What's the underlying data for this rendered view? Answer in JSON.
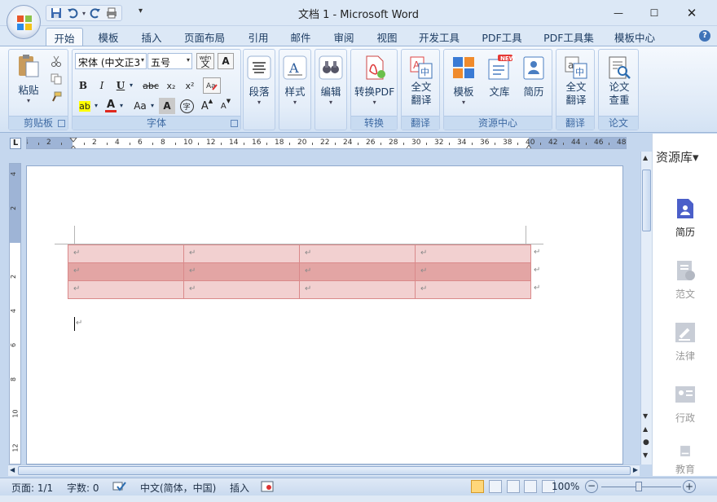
{
  "window": {
    "title": "文档 1 - Microsoft Word",
    "minimize": "—",
    "maximize": "☐",
    "close": "✕"
  },
  "qat": {
    "customize": "▾"
  },
  "tabs": [
    "开始",
    "模板",
    "插入",
    "页面布局",
    "引用",
    "邮件",
    "审阅",
    "视图",
    "开发工具",
    "PDF工具",
    "PDF工具集",
    "模板中心"
  ],
  "active_tab": "开始",
  "help": "?",
  "ribbon": {
    "clipboard": {
      "label": "剪贴板",
      "paste": "粘贴"
    },
    "font": {
      "label": "字体",
      "font_name": "宋体 (中文正3",
      "font_size": "五号",
      "wen_label": "wén",
      "wen_char": "文",
      "a_boxed": "A",
      "bold": "B",
      "italic": "I",
      "underline": "U",
      "strike": "abc",
      "subscript": "x₂",
      "superscript": "x²",
      "highlight": "ab",
      "font_color": "A",
      "change_case": "Aa",
      "char_shade": "A",
      "enclose": "字",
      "grow": "A",
      "shrink": "A"
    },
    "paragraph": {
      "label": "段落"
    },
    "styles": {
      "label": "样式"
    },
    "editing": {
      "label": "编辑"
    },
    "convert": {
      "group": "转换",
      "button": "转换PDF"
    },
    "translate": {
      "group": "翻译",
      "button_line1": "全文",
      "button_line2": "翻译"
    },
    "resource": {
      "group": "资源中心",
      "template": "模板",
      "library": "文库",
      "resume": "简历",
      "new_badge": "NEW"
    },
    "translate2": {
      "group": "翻译",
      "button_line1": "全文",
      "button_line2": "翻译"
    },
    "paper": {
      "group": "论文",
      "button_line1": "论文",
      "button_line2": "查重"
    }
  },
  "ruler": {
    "h_labels": [
      "4",
      "2",
      "",
      "2",
      "4",
      "6",
      "8",
      "10",
      "12",
      "14",
      "16",
      "18",
      "20",
      "22",
      "24",
      "26",
      "28",
      "30",
      "32",
      "34",
      "36",
      "38",
      "40",
      "42",
      "44",
      "46",
      "48"
    ],
    "v_labels": [
      "4",
      "2",
      "",
      "2",
      "4",
      "6",
      "8",
      "10",
      "12"
    ],
    "corner": "L"
  },
  "document": {
    "table_rows": 3,
    "table_cols": 4,
    "para_mark": "↵",
    "colors": {
      "row_light": "#f2d0d0",
      "row_dark": "#e3a5a4",
      "border": "#d9898a"
    }
  },
  "side_panel": {
    "title": "资源库",
    "caret": "▾",
    "items": [
      {
        "label": "简历",
        "active": true
      },
      {
        "label": "范文",
        "active": false
      },
      {
        "label": "法律",
        "active": false
      },
      {
        "label": "行政",
        "active": false
      },
      {
        "label": "教育",
        "active": false
      }
    ]
  },
  "status": {
    "page": "页面: 1/1",
    "words": "字数: 0",
    "language": "中文(简体，中国)",
    "mode": "插入",
    "zoom": "100%",
    "zoom_minus": "−",
    "zoom_plus": "+"
  }
}
